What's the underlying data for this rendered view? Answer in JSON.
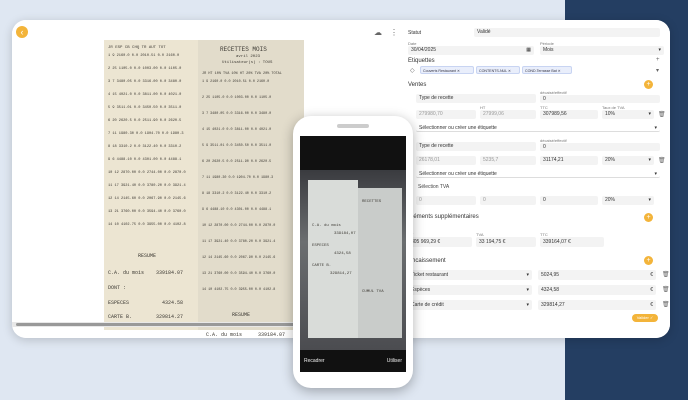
{
  "viewer": {
    "receipt_left": {
      "header": [
        "JR",
        "ESP",
        "CB",
        "CHQ",
        "TR",
        "AUT",
        "TOT"
      ],
      "rows": [
        "1  9 2160.0 0.0 2010.51 0.0 2160.0",
        "2  25 1105.0 0.0 1003.00 0.0 1105.0",
        "3  7 3480.05 0.0 3316.00 0.0 3480.0",
        "4  15 4021.0 0.0 3811.00 0.0 4021.0",
        "5  9 3511.01 0.0 3450.50 0.0 3511.0",
        "6  20 2620.5 0.0 2511.90 0.0 2620.5",
        "7  11 1980.30 0.0 1904.70 0.0 1980.3",
        "8  18 3310.2 0.0 3122.40 0.0 3310.2",
        "9  6 4488.10 0.0 4301.00 0.0 4488.1",
        "10 12 2870.00 0.0 2744.00 0.0 2870.0",
        "11 17 3921.40 0.0 3780.20 0.0 3921.4",
        "12 14 2145.60 0.0 2067.90 0.0 2145.6",
        "13 21 3760.00 0.0 3594.40 0.0 3760.0",
        "14 10 4102.75 0.0 3955.00 0.0 4102.8"
      ],
      "resume_label": "RESUME",
      "ca_label": "C.A. du mois",
      "ca_value": "339184.07",
      "dont_label": "DONT :",
      "especes_label": "ESPECES",
      "especes_value": "4324.58",
      "carte_label": "CARTE B.",
      "carte_value": "329814.27"
    },
    "receipt_right": {
      "title": "RECETTES MOIS",
      "subtitle": "avril 2023",
      "user": "Utilisateur(s) : TOUS",
      "header": [
        "JR",
        "HT 10%",
        "TVA 10%",
        "HT 20%",
        "TVA 20%",
        "TOTAL"
      ],
      "resume_label": "RESUME",
      "ca_label": "C.A. du mois",
      "ca_value": "339184.07"
    }
  },
  "form": {
    "statut_label": "Statut",
    "statut_value": "Validé",
    "date_label": "Date",
    "date_value": "30/04/2025",
    "periode_label": "Période",
    "periode_value": "Mois",
    "etiquettes_label": "Etiquettes",
    "tags": [
      "Couverts Restaurant",
      "CONTENTS-NUL",
      "COND.Terrasse Bat"
    ],
    "ventes_label": "Ventes",
    "vente1_type": "Type de recette",
    "vente1_auto_label": "décaisé/effectif",
    "vente1_auto_value": "0",
    "vente1_ht_label": "HT",
    "vente1_ht_value": "279980,70",
    "vente1_tva_label": "TVA",
    "vente1_tva_value": "27999,06",
    "vente1_ttc_label": "TTC",
    "vente1_ttc_value": "307989,56",
    "vente1_rate_label": "Taux de TVA",
    "vente1_rate_value": "10%",
    "vente1_link": "Sélectionner ou créer une étiquette",
    "vente2_type": "Type de recette",
    "vente2_auto_label": "décaisé/effectif",
    "vente2_auto_value": "0",
    "vente2_ht_value": "26178,01",
    "vente2_tva_value": "5235,7",
    "vente2_ttc_value": "31174,21",
    "vente2_rate_value": "20%",
    "vente2_link": "Sélectionner ou créer une étiquette",
    "vente3_type": "Sélection TVA",
    "vente3_ht_value": "0",
    "vente3_tva_value": "0",
    "vente3_ttc_value": "0",
    "vente3_rate_value": "20%",
    "complement_label": "Éléments supplémentaires",
    "totals": [
      "305 969,29 €",
      "33 194,75 €",
      "339164,07 €"
    ],
    "totals_labels": [
      "HT",
      "TVA",
      "TTC"
    ],
    "encaissement_label": "Encaissement",
    "pay_rows": [
      {
        "label": "Ticket restaurant",
        "value": "5024,95",
        "cur": "€"
      },
      {
        "label": "Espèces",
        "value": "4324,58",
        "cur": "€"
      },
      {
        "label": "Carte de crédit",
        "value": "329814,27",
        "cur": "€"
      }
    ],
    "save_label": "Valider"
  },
  "phone": {
    "left_btn": "Recadrer",
    "right_btn": "Utiliser",
    "lines": [
      "C.A. du mois",
      "339184,07",
      "ESPECES",
      "4324,58",
      "CARTE B.",
      "329814,27",
      "RECETTES",
      "CUMUL TVA"
    ]
  }
}
